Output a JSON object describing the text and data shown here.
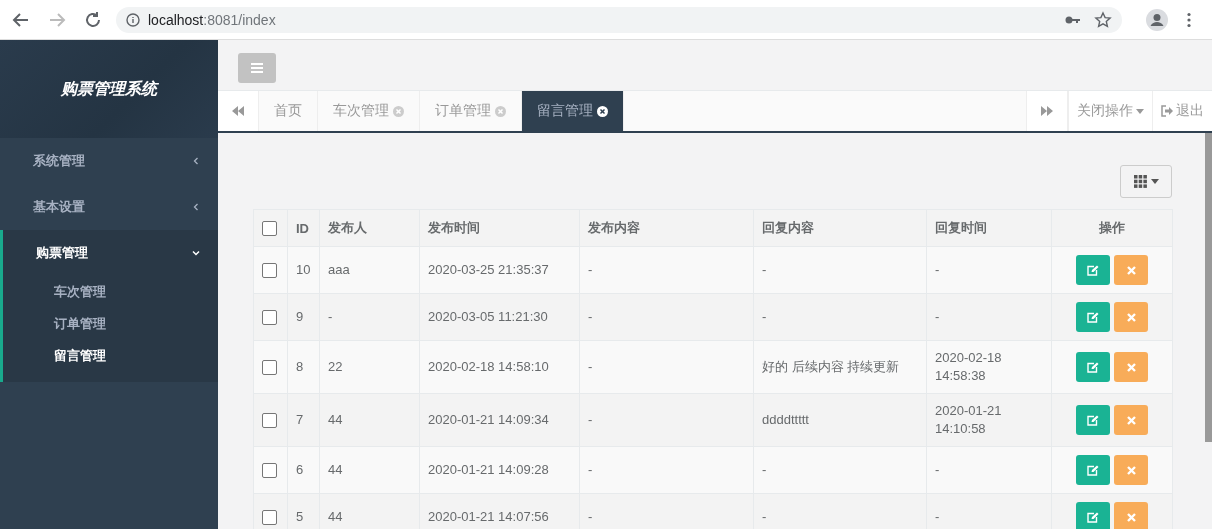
{
  "browser": {
    "url_host": "localhost",
    "url_rest": ":8081/index"
  },
  "sidebar": {
    "title": "购票管理系统",
    "items": [
      {
        "label": "系统管理",
        "expanded": false,
        "selected": false
      },
      {
        "label": "基本设置",
        "expanded": false,
        "selected": false
      },
      {
        "label": "购票管理",
        "expanded": true,
        "selected": true,
        "children": [
          {
            "label": "车次管理",
            "selected": false
          },
          {
            "label": "订单管理",
            "selected": false
          },
          {
            "label": "留言管理",
            "selected": true
          }
        ]
      }
    ]
  },
  "tabs": [
    {
      "label": "首页",
      "closable": false,
      "selected": false
    },
    {
      "label": "车次管理",
      "closable": true,
      "selected": false
    },
    {
      "label": "订单管理",
      "closable": true,
      "selected": false
    },
    {
      "label": "留言管理",
      "closable": true,
      "selected": true
    }
  ],
  "tab_actions": {
    "close_menu": "关闭操作",
    "logout": "退出"
  },
  "table": {
    "select_all_checked": false,
    "columns": [
      "ID",
      "发布人",
      "发布时间",
      "发布内容",
      "回复内容",
      "回复时间",
      "操作"
    ],
    "rows": [
      {
        "checked": false,
        "cells": [
          "10",
          "aaa",
          "2020-03-25 21:35:37",
          "-",
          "-",
          "-"
        ]
      },
      {
        "checked": false,
        "cells": [
          "9",
          "-",
          "2020-03-05 11:21:30",
          "-",
          "-",
          "-"
        ]
      },
      {
        "checked": false,
        "cells": [
          "8",
          "22",
          "2020-02-18 14:58:10",
          "-",
          "好的 后续内容 持续更新",
          "2020-02-18 14:58:38"
        ]
      },
      {
        "checked": false,
        "cells": [
          "7",
          "44",
          "2020-01-21 14:09:34",
          "-",
          "ddddttttt",
          "2020-01-21 14:10:58"
        ]
      },
      {
        "checked": false,
        "cells": [
          "6",
          "44",
          "2020-01-21 14:09:28",
          "-",
          "-",
          "-"
        ]
      },
      {
        "checked": false,
        "cells": [
          "5",
          "44",
          "2020-01-21 14:07:56",
          "-",
          "-",
          "-"
        ]
      }
    ]
  }
}
